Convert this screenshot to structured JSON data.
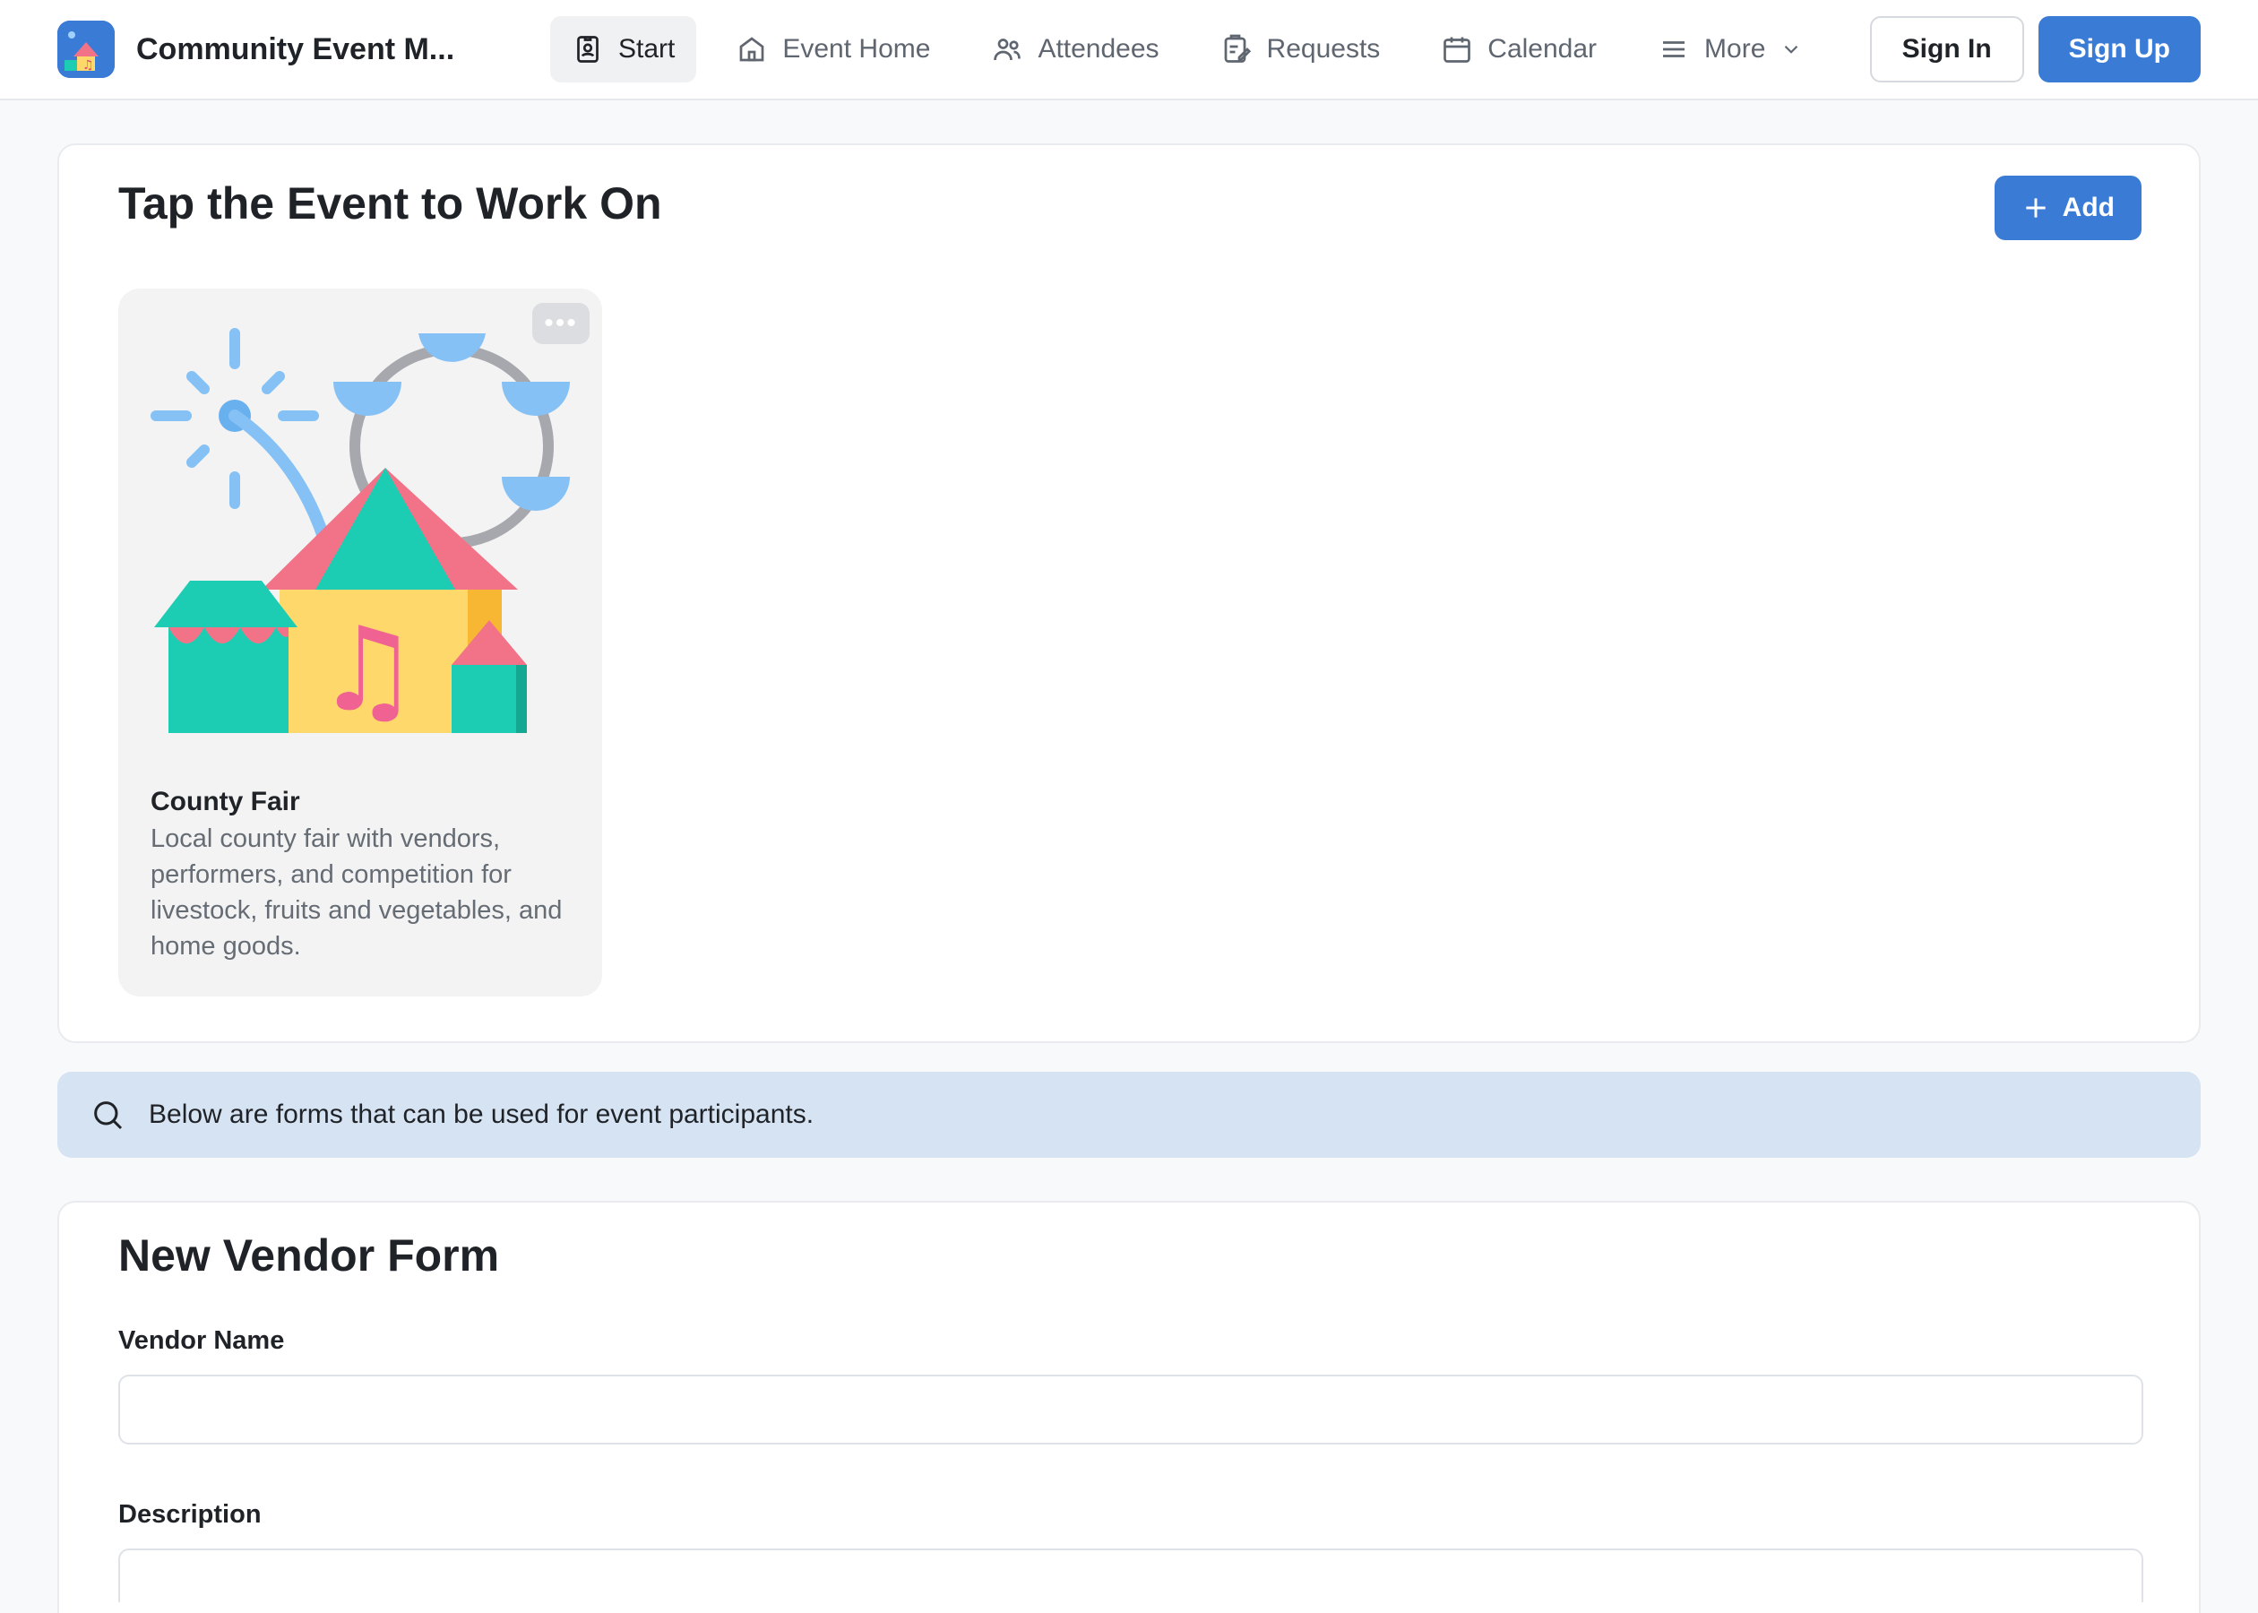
{
  "app": {
    "title": "Community Event M...",
    "accent_color": "#3a7bd5"
  },
  "nav": {
    "items": [
      {
        "label": "Start",
        "icon": "contact-badge-icon",
        "active": true
      },
      {
        "label": "Event Home",
        "icon": "home-icon",
        "active": false
      },
      {
        "label": "Attendees",
        "icon": "users-icon",
        "active": false
      },
      {
        "label": "Requests",
        "icon": "clipboard-edit-icon",
        "active": false
      },
      {
        "label": "Calendar",
        "icon": "calendar-icon",
        "active": false
      },
      {
        "label": "More",
        "icon": "menu-icon",
        "active": false
      }
    ]
  },
  "auth": {
    "sign_in": "Sign In",
    "sign_up": "Sign Up"
  },
  "events_section": {
    "title": "Tap the Event to Work On",
    "add_label": "Add",
    "events": [
      {
        "name": "County Fair",
        "description": "Local county fair with vendors, performers, and competition for livestock, fruits and vegetables, and home goods.",
        "image": "county-fair-illustration"
      }
    ]
  },
  "info_bar": {
    "text": "Below are forms that can be used for event participants."
  },
  "vendor_form": {
    "title": "New Vendor Form",
    "fields": [
      {
        "label": "Vendor Name",
        "value": "",
        "placeholder": ""
      },
      {
        "label": "Description",
        "value": "",
        "placeholder": ""
      }
    ]
  }
}
